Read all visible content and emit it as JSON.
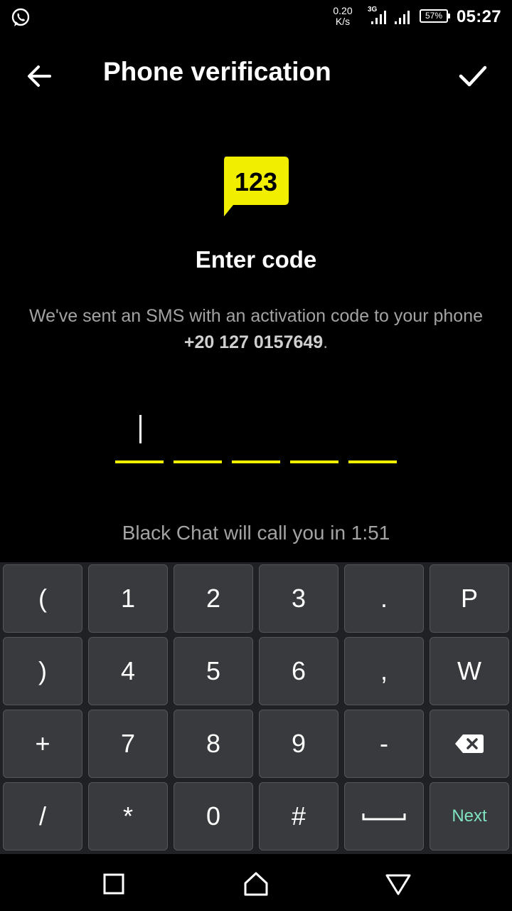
{
  "status_bar": {
    "speed_value": "0.20",
    "speed_unit": "K/s",
    "network_type": "3G",
    "battery_percent": "57%",
    "time": "05:27"
  },
  "app_bar": {
    "title": "Phone verification",
    "back_icon": "arrow-left-icon",
    "confirm_icon": "check-icon"
  },
  "content": {
    "icon_text": "123",
    "heading": "Enter code",
    "desc_prefix": "We've sent an SMS with an activation code to your phone ",
    "phone_number": "+20 127 0157649",
    "desc_suffix": ".",
    "code_digits": 5,
    "call_note": "Black Chat will call you in 1:51"
  },
  "keyboard": {
    "rows": [
      [
        "(",
        "1",
        "2",
        "3",
        ".",
        "P"
      ],
      [
        ")",
        "4",
        "5",
        "6",
        ",",
        "W"
      ],
      [
        "+",
        "7",
        "8",
        "9",
        "-",
        "backspace-icon"
      ],
      [
        "/",
        "*",
        "0",
        "#",
        "space-icon",
        "Next"
      ]
    ]
  },
  "colors": {
    "accent_yellow": "#f2ee00",
    "next_key": "#7fe3c0",
    "muted_text": "#a3a3a3"
  },
  "nav_bar": {
    "icons": [
      "recents-square-icon",
      "home-icon",
      "back-triangle-icon"
    ]
  }
}
